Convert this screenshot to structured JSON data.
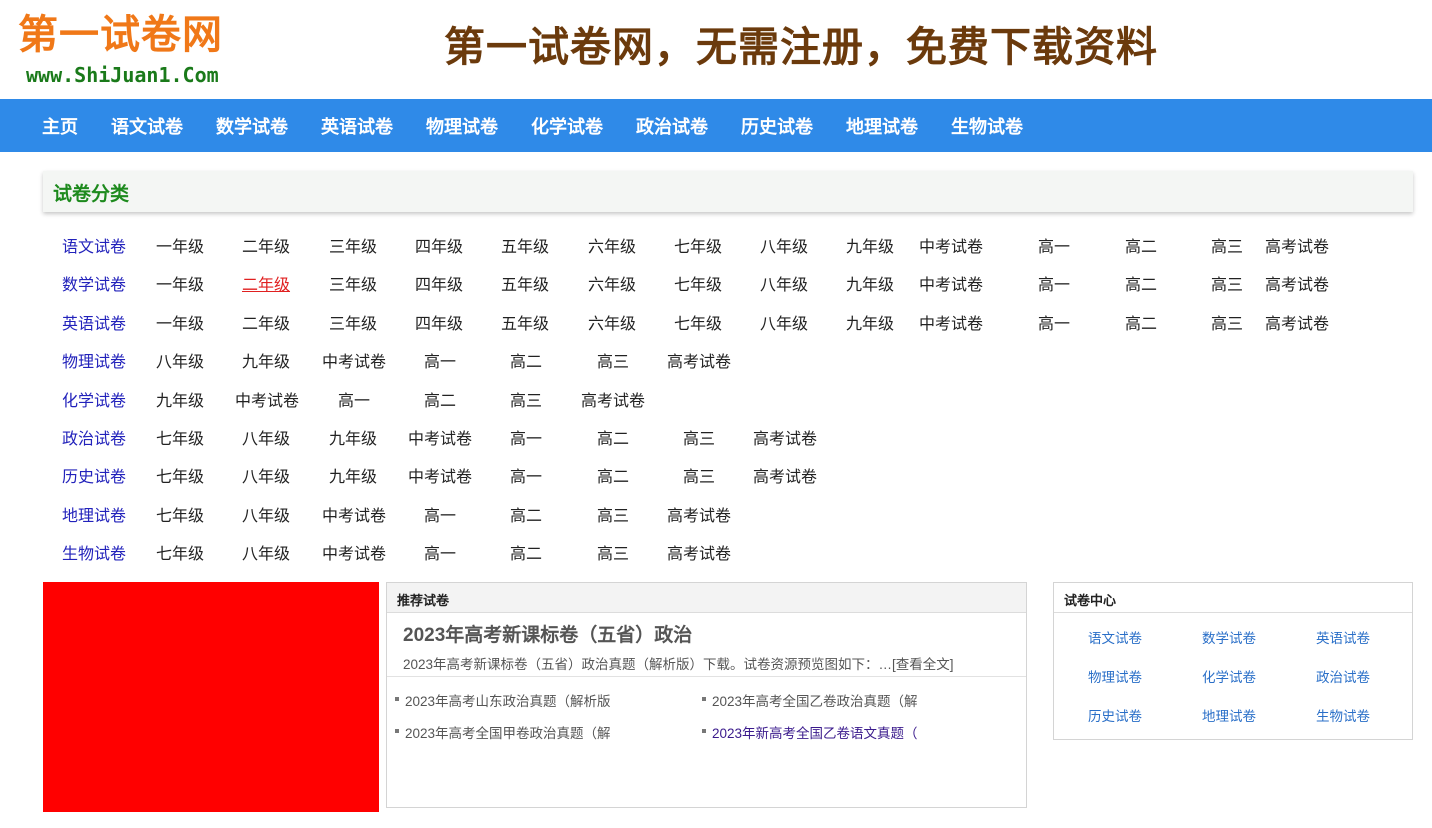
{
  "header": {
    "logo_cn": "第一试卷网",
    "logo_url": "www.ShiJuan1.Com",
    "slogan": "第一试卷网，无需注册，免费下载资料"
  },
  "nav": {
    "items": [
      "主页",
      "语文试卷",
      "数学试卷",
      "英语试卷",
      "物理试卷",
      "化学试卷",
      "政治试卷",
      "历史试卷",
      "地理试卷",
      "生物试卷"
    ]
  },
  "category": {
    "title": "试卷分类",
    "rows": [
      {
        "subject": "语文试卷",
        "grades": [
          "一年级",
          "二年级",
          "三年级",
          "四年级",
          "五年级",
          "六年级",
          "七年级",
          "八年级",
          "九年级",
          "中考试卷",
          "高一",
          "高二",
          "高三",
          "高考试卷"
        ]
      },
      {
        "subject": "数学试卷",
        "grades": [
          "一年级",
          "二年级",
          "三年级",
          "四年级",
          "五年级",
          "六年级",
          "七年级",
          "八年级",
          "九年级",
          "中考试卷",
          "高一",
          "高二",
          "高三",
          "高考试卷"
        ]
      },
      {
        "subject": "英语试卷",
        "grades": [
          "一年级",
          "二年级",
          "三年级",
          "四年级",
          "五年级",
          "六年级",
          "七年级",
          "八年级",
          "九年级",
          "中考试卷",
          "高一",
          "高二",
          "高三",
          "高考试卷"
        ]
      },
      {
        "subject": "物理试卷",
        "grades": [
          "八年级",
          "九年级",
          "中考试卷",
          "高一",
          "高二",
          "高三",
          "高考试卷"
        ]
      },
      {
        "subject": "化学试卷",
        "grades": [
          "九年级",
          "中考试卷",
          "高一",
          "高二",
          "高三",
          "高考试卷"
        ]
      },
      {
        "subject": "政治试卷",
        "grades": [
          "七年级",
          "八年级",
          "九年级",
          "中考试卷",
          "高一",
          "高二",
          "高三",
          "高考试卷"
        ]
      },
      {
        "subject": "历史试卷",
        "grades": [
          "七年级",
          "八年级",
          "九年级",
          "中考试卷",
          "高一",
          "高二",
          "高三",
          "高考试卷"
        ]
      },
      {
        "subject": "地理试卷",
        "grades": [
          "七年级",
          "八年级",
          "中考试卷",
          "高一",
          "高二",
          "高三",
          "高考试卷"
        ]
      },
      {
        "subject": "生物试卷",
        "grades": [
          "七年级",
          "八年级",
          "中考试卷",
          "高一",
          "高二",
          "高三",
          "高考试卷"
        ]
      }
    ],
    "active": {
      "row": 1,
      "grade": 1
    }
  },
  "recommend": {
    "heading": "推荐试卷",
    "title": "2023年高考新课标卷（五省）政治",
    "desc": "2023年高考新课标卷（五省）政治真题（解析版）下载。试卷资源预览图如下：…",
    "more": "[查看全文]",
    "links": [
      {
        "text": "2023年高考山东政治真题（解析版",
        "visited": false
      },
      {
        "text": "2023年高考全国乙卷政治真题（解",
        "visited": false
      },
      {
        "text": "2023年高考全国甲卷政治真题（解",
        "visited": false
      },
      {
        "text": "2023年新高考全国乙卷语文真题（",
        "visited": true
      }
    ]
  },
  "center": {
    "heading": "试卷中心",
    "links": [
      "语文试卷",
      "数学试卷",
      "英语试卷",
      "物理试卷",
      "化学试卷",
      "政治试卷",
      "历史试卷",
      "地理试卷",
      "生物试卷"
    ]
  },
  "colors": {
    "nav_bg": "#2f8ae8",
    "subject_link": "#2222bb",
    "active_grade": "#e02020",
    "category_title": "#1d8a1d",
    "ad_block": "#ff0000"
  }
}
